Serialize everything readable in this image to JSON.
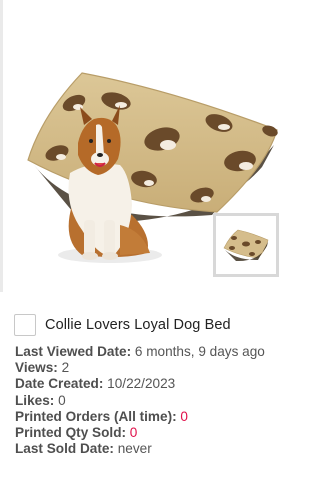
{
  "product": {
    "title": "Collie Lovers Loyal Dog Bed",
    "image_alt": "Dog bed with collie pattern",
    "thumbnail_alt": "Dog bed thumbnail"
  },
  "stats": {
    "last_viewed": {
      "label": "Last Viewed Date:",
      "value": " 6 months, 9 days ago"
    },
    "views": {
      "label": "Views:",
      "value": " 2"
    },
    "date_created": {
      "label": "Date Created:",
      "value": " 10/22/2023"
    },
    "likes": {
      "label": "Likes:",
      "value": " 0"
    },
    "printed_orders": {
      "label": "Printed Orders (All time):",
      "value": " 0"
    },
    "printed_qty": {
      "label": "Printed Qty Sold:",
      "value": " 0"
    },
    "last_sold": {
      "label": "Last Sold Date:",
      "value": " never"
    }
  },
  "colors": {
    "bed_fabric": "#d5bd8c",
    "highlight_value": "#e0104a",
    "thumb_border": "#d8d8d8"
  }
}
